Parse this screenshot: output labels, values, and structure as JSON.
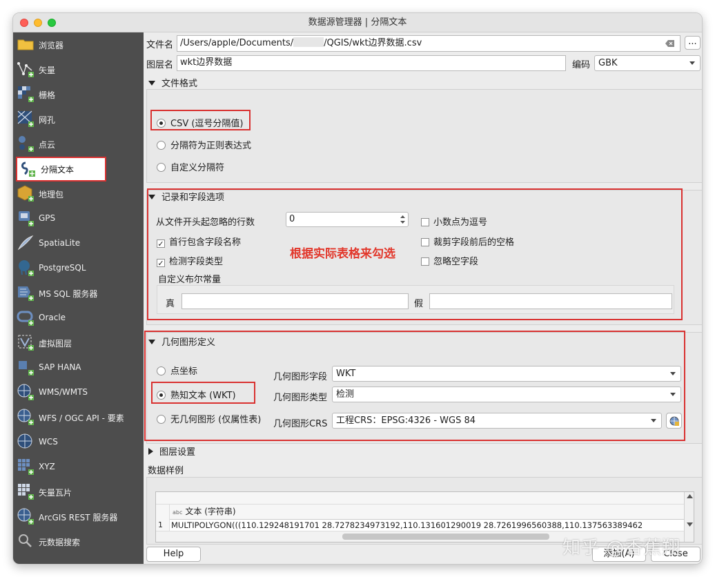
{
  "window": {
    "title": "数据源管理器 | 分隔文本"
  },
  "sidebar": {
    "items": [
      {
        "label": "浏览器",
        "icon": "folder-icon"
      },
      {
        "label": "矢量",
        "icon": "vector-icon"
      },
      {
        "label": "栅格",
        "icon": "raster-icon"
      },
      {
        "label": "网孔",
        "icon": "mesh-icon"
      },
      {
        "label": "点云",
        "icon": "point-cloud-icon"
      },
      {
        "label": "分隔文本",
        "icon": "delimited-text-icon"
      },
      {
        "label": "地理包",
        "icon": "geopackage-icon"
      },
      {
        "label": "GPS",
        "icon": "gps-icon"
      },
      {
        "label": "SpatiaLite",
        "icon": "spatialite-icon"
      },
      {
        "label": "PostgreSQL",
        "icon": "postgresql-icon"
      },
      {
        "label": "MS SQL 服务器",
        "icon": "mssql-icon"
      },
      {
        "label": "Oracle",
        "icon": "oracle-icon"
      },
      {
        "label": "虚拟图层",
        "icon": "virtual-layer-icon"
      },
      {
        "label": "SAP HANA",
        "icon": "sap-hana-icon"
      },
      {
        "label": "WMS/WMTS",
        "icon": "wms-icon"
      },
      {
        "label": "WFS / OGC API - 要素",
        "icon": "wfs-icon"
      },
      {
        "label": "WCS",
        "icon": "wcs-icon"
      },
      {
        "label": "XYZ",
        "icon": "xyz-icon"
      },
      {
        "label": "矢量瓦片",
        "icon": "vector-tile-icon"
      },
      {
        "label": "ArcGIS REST 服务器",
        "icon": "arcgis-icon"
      },
      {
        "label": "元数据搜索",
        "icon": "metadata-search-icon"
      }
    ]
  },
  "file": {
    "label": "文件名",
    "path_prefix": "/Users/apple/Documents/",
    "path_suffix": "/QGIS/wkt边界数据.csv",
    "browse_label": "..."
  },
  "layer": {
    "label": "图层名",
    "value": "wkt边界数据",
    "encoding_label": "编码",
    "encoding_value": "GBK"
  },
  "file_format": {
    "title": "文件格式",
    "options": [
      "CSV (逗号分隔值)",
      "分隔符为正则表达式",
      "自定义分隔符"
    ]
  },
  "records": {
    "title": "记录和字段选项",
    "skip_label": "从文件开头起忽略的行数",
    "skip_value": "0",
    "first_record_header": "首行包含字段名称",
    "detect_types": "检测字段类型",
    "decimal_comma": "小数点为逗号",
    "trim_fields": "裁剪字段前后的空格",
    "discard_empty": "忽略空字段",
    "boolean_label": "自定义布尔常量",
    "true_label": "真",
    "false_label": "假",
    "annotation": "根据实际表格来勾选"
  },
  "geometry": {
    "title": "几何图形定义",
    "options": [
      "点坐标",
      "熟知文本 (WKT)",
      "无几何图形 (仅属性表)"
    ],
    "field_label": "几何图形字段",
    "field_value": "WKT",
    "type_label": "几何图形类型",
    "type_value": "检测",
    "crs_label": "几何图形CRS",
    "crs_value": "工程CRS：EPSG:4326 - WGS 84"
  },
  "layer_settings": {
    "title": "图层设置"
  },
  "sample": {
    "title": "数据样例",
    "column_header": "文本 (字符串)",
    "column_type_badge": "abc",
    "row_number": "1",
    "row_value": "MULTIPOLYGON(((110.129248191701 28.7278234973192,110.131601290019 28.7261996560388,110.137563389462"
  },
  "footer": {
    "help_label": "Help",
    "add_label": "添加(A)",
    "close_label": "Close",
    "watermark": "知乎 @香蕉翔"
  }
}
